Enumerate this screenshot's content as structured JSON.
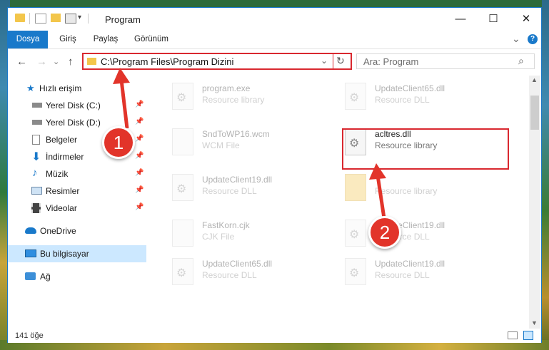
{
  "window": {
    "title": "Program",
    "buttons": {
      "minimize": "—",
      "maximize": "☐",
      "close": "✕"
    }
  },
  "ribbon": {
    "tabs": [
      {
        "label": "Dosya",
        "active": true
      },
      {
        "label": "Giriş"
      },
      {
        "label": "Paylaş"
      },
      {
        "label": "Görünüm"
      }
    ],
    "expand_icon": "⌄",
    "help_icon": "?"
  },
  "navigation": {
    "back": "←",
    "forward": "→",
    "dropdown": "⌄",
    "up": "↑",
    "address": "C:\\Program Files\\Program Dizini",
    "address_dropdown": "⌄",
    "refresh": "↻",
    "search_placeholder": "Ara: Program",
    "search_icon": "⌕"
  },
  "sidebar": {
    "items": [
      {
        "label": "Hızlı erişim",
        "icon": "star-icon",
        "pinned": false
      },
      {
        "label": "Yerel Disk (C:)",
        "icon": "drive-icon",
        "pinned": true
      },
      {
        "label": "Yerel Disk (D:)",
        "icon": "drive-icon",
        "pinned": true
      },
      {
        "label": "Belgeler",
        "icon": "documents-icon",
        "pinned": true
      },
      {
        "label": "İndirmeler",
        "icon": "download-icon",
        "pinned": true
      },
      {
        "label": "Müzik",
        "icon": "music-icon",
        "pinned": true
      },
      {
        "label": "Resimler",
        "icon": "pictures-icon",
        "pinned": true
      },
      {
        "label": "Videolar",
        "icon": "videos-icon",
        "pinned": true
      },
      {
        "label": "OneDrive",
        "icon": "cloud-icon",
        "pinned": false
      },
      {
        "label": "Bu bilgisayar",
        "icon": "computer-icon",
        "pinned": false,
        "selected": true
      },
      {
        "label": "Ağ",
        "icon": "network-icon",
        "pinned": false
      }
    ],
    "pin_glyph": "📌"
  },
  "files": [
    {
      "name": "program.exe",
      "type": "Resource library"
    },
    {
      "name": "UpdateClient65.dll",
      "type": "Resource DLL"
    },
    {
      "name": "SndToWP16.wcm",
      "type": "WCM File"
    },
    {
      "name": "acltres.dll",
      "type": "Resource library"
    },
    {
      "name": "UpdateClient19.dll",
      "type": "Resource DLL"
    },
    {
      "name": "",
      "type": "Resource library"
    },
    {
      "name": "FastKorn.cjk",
      "type": "CJK File"
    },
    {
      "name": "UpdateClient19.dll",
      "type": "Resource DLL"
    },
    {
      "name": "UpdateClient65.dll",
      "type": "Resource DLL"
    },
    {
      "name": "UpdateClient19.dll",
      "type": "Resource DLL"
    }
  ],
  "status": {
    "item_count": "141 öğe"
  },
  "annotations": {
    "badge1": "1",
    "badge2": "2",
    "accent": "#d9282f"
  },
  "colors": {
    "ribbon_accent": "#1979ca",
    "selected_row": "#cce8ff"
  }
}
